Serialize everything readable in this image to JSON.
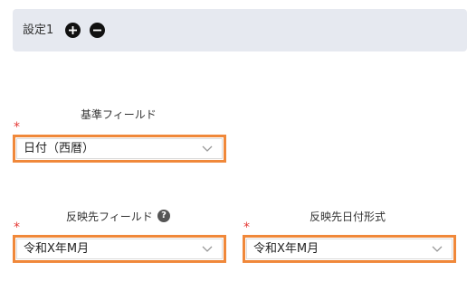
{
  "header": {
    "title": "設定1",
    "add_icon": "plus-circle-icon",
    "remove_icon": "minus-circle-icon"
  },
  "fields": {
    "base_field": {
      "label": "基準フィールド",
      "required_mark": "*",
      "value": "日付（西暦）"
    },
    "target_field": {
      "label": "反映先フィールド",
      "required_mark": "*",
      "value": "令和X年M月",
      "help_icon": "?"
    },
    "target_date_format": {
      "label": "反映先日付形式",
      "required_mark": "*",
      "value": "令和X年M月"
    }
  },
  "colors": {
    "highlight_border": "#f0883a",
    "required": "#e53935",
    "header_bg": "#e6e9f0"
  }
}
